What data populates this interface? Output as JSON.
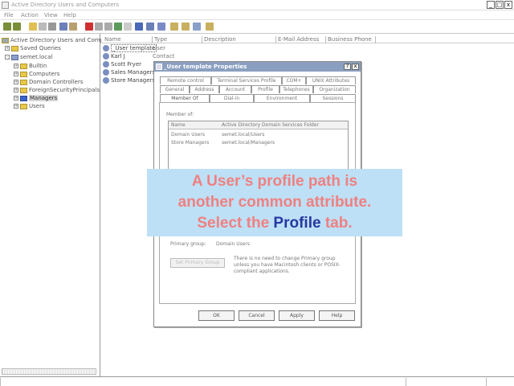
{
  "window": {
    "title": "Active Directory Users and Computers",
    "controls": [
      "_",
      "□",
      "x"
    ]
  },
  "menu": [
    "File",
    "Action",
    "View",
    "Help"
  ],
  "tree": {
    "items": [
      {
        "label": "Active Directory Users and Comput",
        "level": 0,
        "expander": ""
      },
      {
        "label": "Saved Queries",
        "level": 1,
        "expander": "+"
      },
      {
        "label": "semet.local",
        "level": 1,
        "expander": "-"
      },
      {
        "label": "Builtin",
        "level": 2,
        "expander": "+"
      },
      {
        "label": "Computers",
        "level": 2,
        "expander": "+"
      },
      {
        "label": "Domain Controllers",
        "level": 2,
        "expander": "+"
      },
      {
        "label": "ForeignSecurityPrincipals",
        "level": 2,
        "expander": "+"
      },
      {
        "label": "Managers",
        "level": 2,
        "expander": "+",
        "selected": true
      },
      {
        "label": "Users",
        "level": 2,
        "expander": "+"
      }
    ]
  },
  "list": {
    "headers": [
      "Name",
      "Type",
      "Description",
      "E-Mail Address",
      "Business Phone"
    ],
    "rows": [
      {
        "name": "_User template",
        "type": "User",
        "selected": true
      },
      {
        "name": "Karl J",
        "type": "Contact"
      },
      {
        "name": "Scott Fryer",
        "type": ""
      },
      {
        "name": "Sales Managers",
        "type": ""
      },
      {
        "name": "Store Managers",
        "type": ""
      }
    ]
  },
  "dialog": {
    "title": "_User template Properties",
    "help": "?",
    "close": "x",
    "tabs_row1": [
      "Remote control",
      "Terminal Services Profile",
      "COM+",
      "UNIX Attributes"
    ],
    "tabs_row2": [
      "General",
      "Address",
      "Account",
      "Profile",
      "Telephones",
      "Organization"
    ],
    "tabs_row3": [
      "Member Of",
      "Dial-in",
      "Environment",
      "Sessions"
    ],
    "active_tab": "Member Of",
    "member_of_label": "Member of:",
    "list_headers": [
      "Name",
      "Active Directory Domain Services Folder"
    ],
    "members": [
      {
        "name": "Domain Users",
        "folder": "semet.local/Users"
      },
      {
        "name": "Store Managers",
        "folder": "semet.local/Managers"
      }
    ],
    "primary_group_label": "Primary group:",
    "primary_group_value": "Domain Users",
    "set_primary_group_button": "Set Primary Group",
    "primary_group_note": "There is no need to change Primary group unless you have Macintosh clients or POSIX-compliant applications.",
    "buttons": [
      "OK",
      "Cancel",
      "Apply",
      "Help"
    ]
  },
  "overlay": {
    "line1": "A User’s profile path is",
    "line2": "another common attribute.",
    "line3_pre": "Select the",
    "line3_highlight": "Profile",
    "line3_post": "tab."
  },
  "colors": {
    "overlay_bg": "#bde0f6",
    "overlay_text": "#f08080",
    "overlay_highlight": "#2838a0",
    "dialog_title_bg": "#8ba0c0"
  }
}
